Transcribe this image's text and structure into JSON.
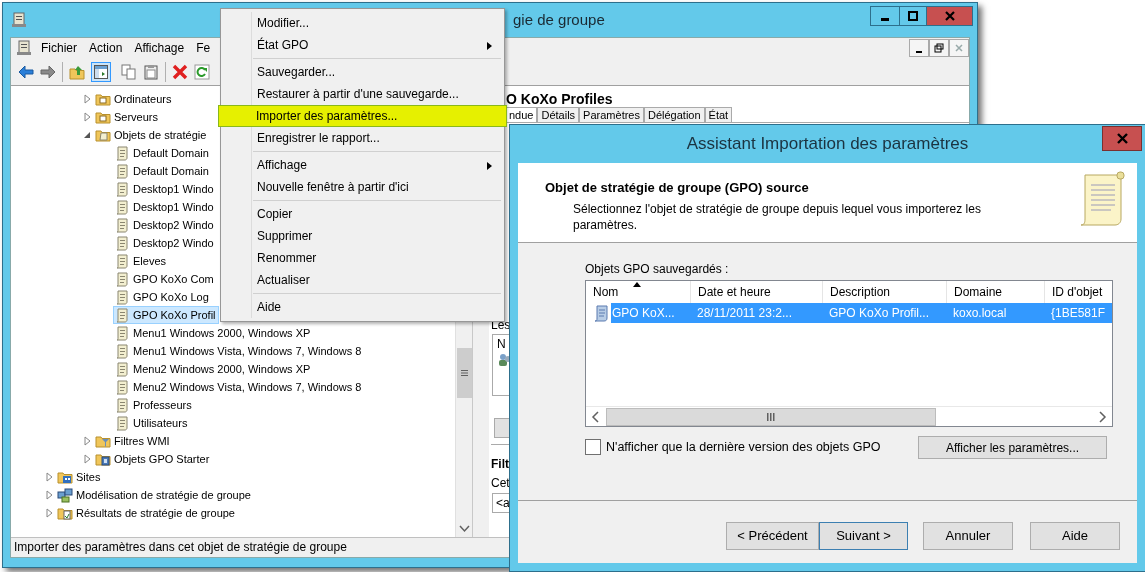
{
  "main_window": {
    "title": "gie de groupe",
    "menu": [
      "Fichier",
      "Action",
      "Affichage",
      "Fe"
    ],
    "tree": {
      "nested_items": [
        {
          "label": "Ordinateurs",
          "kind": "ou",
          "expanded": false,
          "selected": false
        },
        {
          "label": "Serveurs",
          "kind": "ou",
          "expanded": false,
          "selected": false
        },
        {
          "label": "Objets de stratégie",
          "kind": "gpo-container",
          "expanded": true,
          "selected": false,
          "children": [
            {
              "label": "Default Domain",
              "kind": "gpo",
              "selected": false
            },
            {
              "label": "Default Domain",
              "kind": "gpo",
              "selected": false
            },
            {
              "label": "Desktop1 Windo",
              "kind": "gpo",
              "selected": false
            },
            {
              "label": "Desktop1 Windo",
              "kind": "gpo",
              "selected": false
            },
            {
              "label": "Desktop2 Windo",
              "kind": "gpo",
              "selected": false
            },
            {
              "label": "Desktop2 Windo",
              "kind": "gpo",
              "selected": false
            },
            {
              "label": "Eleves",
              "kind": "gpo",
              "selected": false
            },
            {
              "label": "GPO KoXo Com",
              "kind": "gpo",
              "selected": false
            },
            {
              "label": "GPO KoXo Log",
              "kind": "gpo",
              "selected": false
            },
            {
              "label": "GPO KoXo Profil",
              "kind": "gpo",
              "selected": true
            },
            {
              "label": "Menu1 Windows 2000, Windows XP",
              "kind": "gpo",
              "selected": false
            },
            {
              "label": "Menu1 Windows Vista, Windows 7, Windows 8",
              "kind": "gpo",
              "selected": false
            },
            {
              "label": "Menu2 Windows 2000, Windows XP",
              "kind": "gpo",
              "selected": false
            },
            {
              "label": "Menu2 Windows Vista, Windows 7, Windows 8",
              "kind": "gpo",
              "selected": false
            },
            {
              "label": "Professeurs",
              "kind": "gpo",
              "selected": false
            },
            {
              "label": "Utilisateurs",
              "kind": "gpo",
              "selected": false
            }
          ]
        },
        {
          "label": "Filtres WMI",
          "kind": "wmi",
          "expanded": false,
          "selected": false
        },
        {
          "label": "Objets GPO Starter",
          "kind": "starter",
          "expanded": false,
          "selected": false
        }
      ],
      "outer_items": [
        {
          "label": "Sites",
          "kind": "sites",
          "expanded": false,
          "selected": false
        },
        {
          "label": "Modélisation de stratégie de groupe",
          "kind": "modeling",
          "expanded": false,
          "selected": false
        },
        {
          "label": "Résultats de stratégie de groupe",
          "kind": "results",
          "expanded": false,
          "selected": false
        }
      ]
    },
    "details_pane": {
      "heading": "O KoXo Profiles",
      "tabs": [
        {
          "label": "ndue",
          "selected": true
        },
        {
          "label": "Détails",
          "selected": false
        },
        {
          "label": "Paramètres",
          "selected": false
        },
        {
          "label": "Délégation",
          "selected": false
        },
        {
          "label": "État",
          "selected": false
        }
      ],
      "links_label": "Les",
      "list_column": "N",
      "filter_heading": "Filt",
      "filter_label": "Cet",
      "filter_value": "<a"
    },
    "status_bar": "Importer des paramètres dans cet objet de stratégie de groupe"
  },
  "context_menu": {
    "items": [
      {
        "kind": "item",
        "label": "Modifier...",
        "submenu": false,
        "selected": false
      },
      {
        "kind": "item",
        "label": "État GPO",
        "submenu": true,
        "selected": false
      },
      {
        "kind": "separator"
      },
      {
        "kind": "item",
        "label": "Sauvegarder...",
        "submenu": false,
        "selected": false
      },
      {
        "kind": "item",
        "label": "Restaurer à partir d'une sauvegarde...",
        "submenu": false,
        "selected": false
      },
      {
        "kind": "item",
        "label": "Importer des paramètres...",
        "submenu": false,
        "selected": true
      },
      {
        "kind": "item",
        "label": "Enregistrer le rapport...",
        "submenu": false,
        "selected": false
      },
      {
        "kind": "separator"
      },
      {
        "kind": "item",
        "label": "Affichage",
        "submenu": true,
        "selected": false
      },
      {
        "kind": "item",
        "label": "Nouvelle fenêtre à partir d'ici",
        "submenu": false,
        "selected": false
      },
      {
        "kind": "separator"
      },
      {
        "kind": "item",
        "label": "Copier",
        "submenu": false,
        "selected": false
      },
      {
        "kind": "item",
        "label": "Supprimer",
        "submenu": false,
        "selected": false
      },
      {
        "kind": "item",
        "label": "Renommer",
        "submenu": false,
        "selected": false
      },
      {
        "kind": "item",
        "label": "Actualiser",
        "submenu": false,
        "selected": false
      },
      {
        "kind": "separator"
      },
      {
        "kind": "item",
        "label": "Aide",
        "submenu": false,
        "selected": false
      }
    ]
  },
  "dialog": {
    "title": "Assistant Importation des paramètres",
    "heading": "Objet de stratégie de groupe (GPO) source",
    "description": "Sélectionnez l'objet de stratégie de groupe depuis lequel vous importerez les paramètres.",
    "list_label": "Objets GPO sauvegardés :",
    "columns": [
      {
        "label": "Nom",
        "sorted": true
      },
      {
        "label": "Date et heure",
        "sorted": false
      },
      {
        "label": "Description",
        "sorted": false
      },
      {
        "label": "Domaine",
        "sorted": false
      },
      {
        "label": "ID d'objet",
        "sorted": false
      }
    ],
    "rows": [
      {
        "cells": [
          "GPO KoX...",
          "28/11/2011 23:2...",
          "GPO KoXo Profil...",
          "koxo.local",
          "{1BE581F"
        ],
        "selected": true
      }
    ],
    "latest_only": {
      "label": "N'afficher que la dernière version des objets GPO",
      "checked": false
    },
    "show_settings_button": "Afficher les paramètres...",
    "buttons": [
      {
        "label": "< Précédent",
        "default": false
      },
      {
        "label": "Suivant >",
        "default": true
      },
      {
        "label": "Annuler",
        "default": false
      },
      {
        "label": "Aide",
        "default": false
      }
    ]
  }
}
